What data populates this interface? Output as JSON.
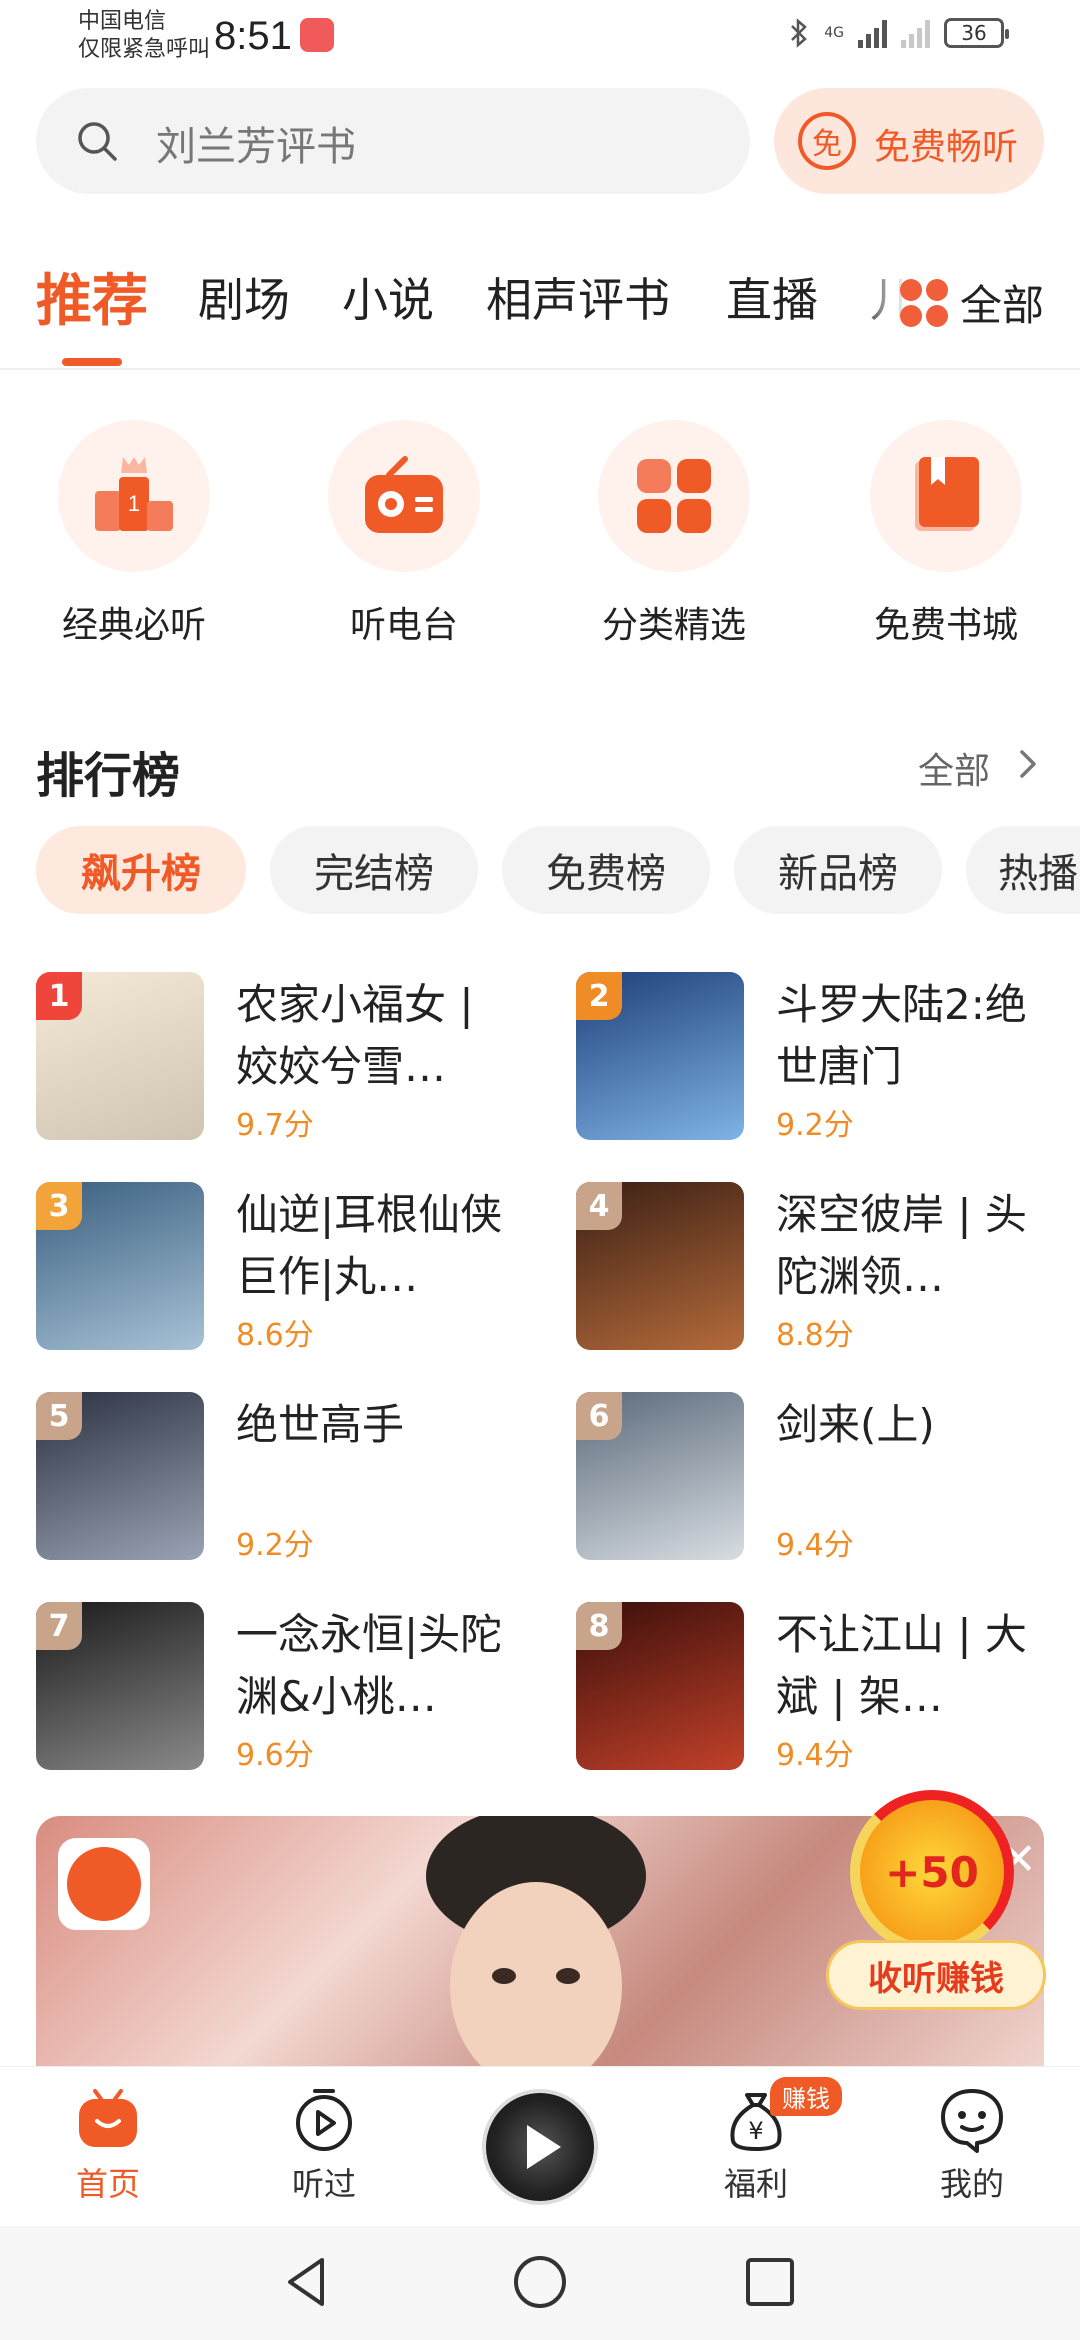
{
  "status_bar": {
    "carrier_line1": "中国电信",
    "carrier_line2": "仅限紧急呼叫",
    "time": "8:51",
    "network": "4G",
    "battery": "36"
  },
  "search": {
    "query": "刘兰芳评书"
  },
  "free_listen": {
    "badge": "免",
    "label": "免费畅听"
  },
  "tabs": [
    {
      "label": "推荐",
      "active": true
    },
    {
      "label": "剧场"
    },
    {
      "label": "小说"
    },
    {
      "label": "相声评书"
    },
    {
      "label": "直播"
    },
    {
      "label": "儿"
    }
  ],
  "all_tabs_label": "全部",
  "quick_entries": [
    {
      "label": "经典必听",
      "icon": "podium-icon"
    },
    {
      "label": "听电台",
      "icon": "radio-icon"
    },
    {
      "label": "分类精选",
      "icon": "category-grid-icon"
    },
    {
      "label": "免费书城",
      "icon": "book-icon"
    }
  ],
  "ranking": {
    "title": "排行榜",
    "all_label": "全部",
    "chips": [
      {
        "label": "飙升榜",
        "active": true
      },
      {
        "label": "完结榜"
      },
      {
        "label": "免费榜"
      },
      {
        "label": "新品榜"
      },
      {
        "label": "热播"
      }
    ],
    "books": [
      {
        "rank": "1",
        "title": "农家小福女 | 姣姣兮雪…",
        "score": "9.7分",
        "badge_color": "#f0453a",
        "cover_colors": [
          "#f5e9d8",
          "#cfc3b2"
        ]
      },
      {
        "rank": "2",
        "title": "斗罗大陆2:绝世唐门",
        "score": "9.2分",
        "badge_color": "#f08c26",
        "cover_colors": [
          "#1e3f7a",
          "#7fb3e6"
        ]
      },
      {
        "rank": "3",
        "title": "仙逆|耳根仙侠巨作|丸…",
        "score": "8.6分",
        "badge_color": "#f2a33a",
        "cover_colors": [
          "#3a5f7f",
          "#a7c2d6"
        ]
      },
      {
        "rank": "4",
        "title": "深空彼岸 | 头陀渊领…",
        "score": "8.8分",
        "badge_color": "#c8a48a",
        "cover_colors": [
          "#3b1f14",
          "#b56b3b"
        ]
      },
      {
        "rank": "5",
        "title": "绝世高手",
        "score": "9.2分",
        "badge_color": "#c8a48a",
        "cover_colors": [
          "#2b3140",
          "#9aa3b5"
        ]
      },
      {
        "rank": "6",
        "title": "剑来(上)",
        "score": "9.4分",
        "badge_color": "#c8a48a",
        "cover_colors": [
          "#5a6a7a",
          "#d8dde2"
        ]
      },
      {
        "rank": "7",
        "title": "一念永恒|头陀渊&小桃…",
        "score": "9.6分",
        "badge_color": "#c8a48a",
        "cover_colors": [
          "#1a1a1a",
          "#8a8a8a"
        ]
      },
      {
        "rank": "8",
        "title": "不让江山 | 大斌 | 架…",
        "score": "9.4分",
        "badge_color": "#c8a48a",
        "cover_colors": [
          "#3a0e0a",
          "#c2412a"
        ]
      }
    ]
  },
  "reward": {
    "amount": "+50",
    "label": "收听赚钱"
  },
  "bottom_nav": [
    {
      "label": "首页",
      "icon": "home-tv-icon",
      "active": true
    },
    {
      "label": "听过",
      "icon": "history-timer-icon"
    },
    {
      "label": "福利",
      "icon": "money-bag-icon",
      "badge": "赚钱"
    },
    {
      "label": "我的",
      "icon": "profile-chat-icon"
    }
  ],
  "colors": {
    "accent": "#f05a26",
    "score": "#f08c26"
  }
}
